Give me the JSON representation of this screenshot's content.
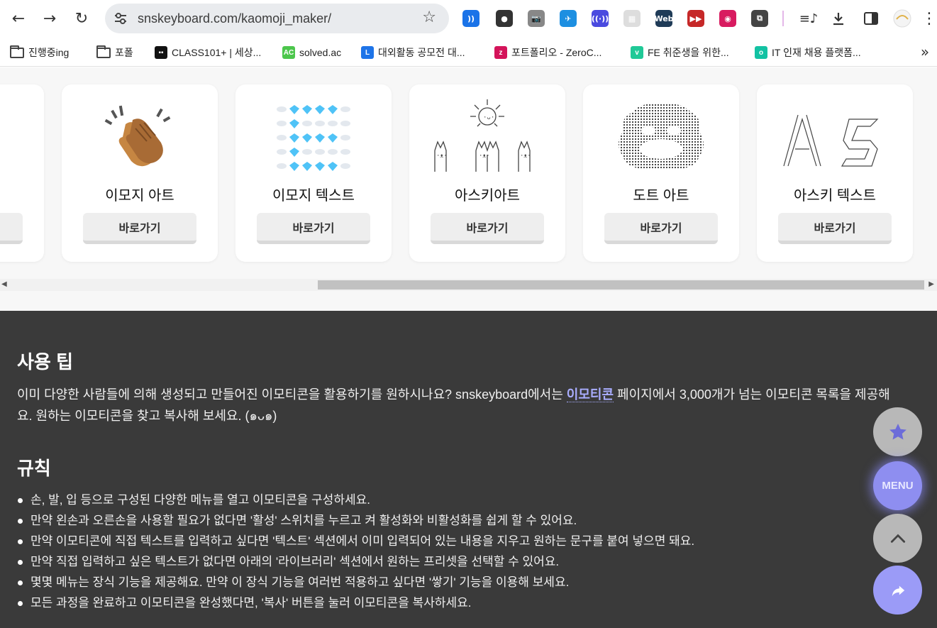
{
  "browser": {
    "url": "snskeyboard.com/kaomoji_maker/",
    "extensions": [
      {
        "name": "wave-extension-icon",
        "color": "#1a73e8",
        "glyph": "))"
      },
      {
        "name": "dark-circle-extension-icon",
        "color": "#333333",
        "glyph": "●"
      },
      {
        "name": "camera-extension-icon",
        "color": "#888888",
        "glyph": "📷"
      },
      {
        "name": "bird-extension-icon",
        "color": "#1d8fe1",
        "glyph": "✈"
      },
      {
        "name": "signal-extension-icon",
        "color": "#4a4adf",
        "glyph": "((·))"
      },
      {
        "name": "faded-extension-icon",
        "color": "#dddddd",
        "glyph": "▦"
      },
      {
        "name": "web-extension-icon",
        "color": "#1f3b57",
        "glyph": "Web"
      },
      {
        "name": "forward-extension-icon",
        "color": "#c62828",
        "glyph": "▶▶"
      },
      {
        "name": "color-picker-extension-icon",
        "color": "#d81b60",
        "glyph": "◉"
      },
      {
        "name": "puzzle-extension-icon",
        "color": "#444444",
        "glyph": "⧉"
      }
    ],
    "bookmarks": [
      {
        "label": "진행중ing",
        "icon": "folder-icon",
        "color": "#444444"
      },
      {
        "label": "포폴",
        "icon": "folder-icon",
        "color": "#444444"
      },
      {
        "label": "CLASS101+ | 세상...",
        "icon": "class101-icon",
        "color": "#111111",
        "glyph": "▪▪"
      },
      {
        "label": "solved.ac",
        "icon": "solved-ac-icon",
        "color": "#4cc64c",
        "glyph": "AC"
      },
      {
        "label": "대외활동 공모전 대...",
        "icon": "linkareer-icon",
        "color": "#1e74e8",
        "glyph": "L"
      },
      {
        "label": "포트폴리오 - ZeroC...",
        "icon": "zerocho-icon",
        "color": "#d4145a",
        "glyph": "z"
      },
      {
        "label": "FE 취준생을 위한...",
        "icon": "velog-icon",
        "color": "#20c997",
        "glyph": "v"
      },
      {
        "label": "IT 인재 채용 플랫폼...",
        "icon": "platform-icon",
        "color": "#13c2a3",
        "glyph": "o"
      }
    ]
  },
  "cards": [
    {
      "title": "이모지 아트",
      "button": "바로가기",
      "art": "clap-emoji"
    },
    {
      "title": "이모지 텍스트",
      "button": "바로가기",
      "art": "emoji-grid"
    },
    {
      "title": "아스키아트",
      "button": "바로가기",
      "art": "ascii-cats"
    },
    {
      "title": "도트 아트",
      "button": "바로가기",
      "art": "dot-art"
    },
    {
      "title": "아스키 텍스트",
      "button": "바로가기",
      "art": "ascii-text"
    }
  ],
  "tips": {
    "heading": "사용 팁",
    "para_line1_before": "이미 다양한 사람들에 의해 생성되고 만들어진 이모티콘을 활용하기를 원하시나요? snskeyboard에서는 ",
    "para_link": "이모티콘",
    "para_line1_after": " 페이지에서 3,000개가 넘는 이모티콘 목록을 제공해",
    "para_line2": "요. 원하는 이모티콘을 찾고 복사해 보세요. (๑ᴗ๑)",
    "rules_heading": "규칙",
    "rules": [
      "손, 발, 입 등으로 구성된 다양한 메뉴를 열고 이모티콘을 구성하세요.",
      "만약 왼손과 오른손을 사용할 필요가 없다면 '활성' 스위치를 누르고 켜 활성화와 비활성화를 쉽게 할 수 있어요.",
      "만약 이모티콘에 직접 텍스트를 입력하고 싶다면 '텍스트' 섹션에서 이미 입력되어 있는 내용을 지우고 원하는 문구를 붙여 넣으면 돼요.",
      "만약 직접 입력하고 싶은 텍스트가 없다면 아래의 '라이브러리' 섹션에서 원하는 프리셋을 선택할 수 있어요.",
      "몇몇 메뉴는 장식 기능을 제공해요. 만약 이 장식 기능을 여러번 적용하고 싶다면 '쌓기' 기능을 이용해 보세요.",
      "모든 과정을 완료하고 이모티콘을 완성했다면, '복사' 버튼을 눌러 이모티콘을 복사하세요."
    ]
  },
  "fab": {
    "menu_label": "MENU"
  },
  "colors": {
    "accent": "#8e8ef0",
    "dark_section": "#3a3a3a",
    "link": "#a9adff"
  }
}
